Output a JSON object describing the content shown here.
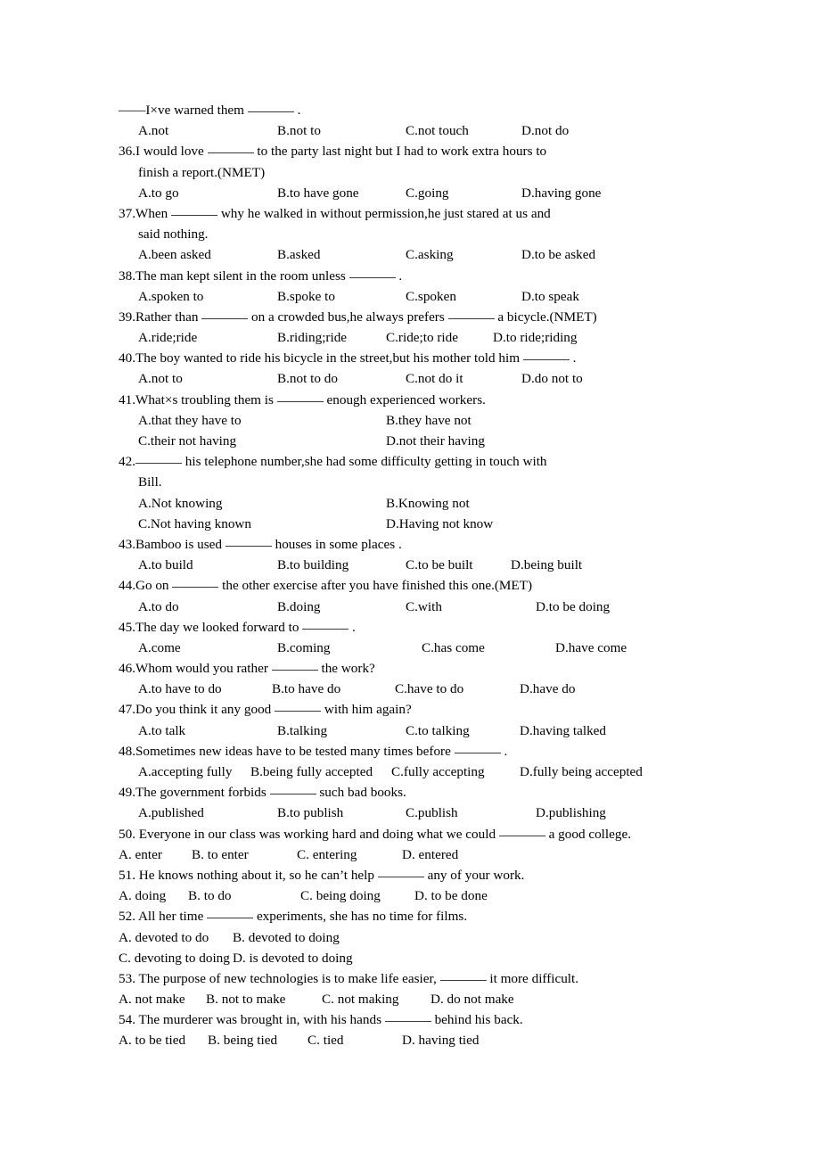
{
  "document": {
    "type": "grammar-worksheet",
    "subject": "English multiple-choice grammar exercise",
    "questions": [
      {
        "number": "",
        "stem_pre": "——I×ve warned them ",
        "stem_post": " .",
        "blank": "md",
        "cont": [],
        "layout": "indent-4col",
        "options": [
          "A.not",
          "B.not to",
          "C.not touch",
          "D.not do"
        ],
        "cols": [
          22,
          178,
          322,
          452
        ]
      },
      {
        "number": "36.",
        "stem_pre": "36.I would love ",
        "stem_post": " to the party last night but I had to work extra hours to",
        "blank": "md",
        "cont": [
          "finish a report.(NMET)"
        ],
        "layout": "indent-4col",
        "options": [
          "A.to go",
          "B.to have gone",
          "C.going",
          "D.having gone"
        ],
        "cols": [
          22,
          178,
          322,
          452
        ]
      },
      {
        "number": "37.",
        "stem_pre": "37.When ",
        "stem_post": " why he walked in without permission,he just stared at us and",
        "blank": "md",
        "cont": [
          "said nothing."
        ],
        "layout": "indent-4col",
        "options": [
          "A.been asked",
          "B.asked",
          "C.asking",
          "D.to be asked"
        ],
        "cols": [
          22,
          178,
          322,
          452
        ]
      },
      {
        "number": "38.",
        "stem_pre": "38.The man kept silent in the room unless ",
        "stem_post": " .",
        "blank": "md",
        "cont": [],
        "layout": "indent-4col",
        "options": [
          "A.spoken to",
          "B.spoke to",
          "C.spoken",
          "D.to speak"
        ],
        "cols": [
          22,
          178,
          322,
          452
        ]
      },
      {
        "number": "39.",
        "stem_pre": "39.Rather than ",
        "stem_mid": " on a crowded bus,he always prefers ",
        "stem_post": " a bicycle.(NMET)",
        "blank": "md",
        "two_blanks": true,
        "cont": [],
        "layout": "indent-4col",
        "options": [
          "A.ride;ride",
          "B.riding;ride",
          "C.ride;to ride",
          "D.to ride;riding"
        ],
        "cols": [
          22,
          178,
          300,
          420
        ]
      },
      {
        "number": "40.",
        "stem_pre": "40.The boy wanted to ride his bicycle in the street,but his mother told him ",
        "stem_post": " .",
        "blank": "md",
        "cont": [],
        "layout": "indent-4col",
        "options": [
          "A.not to",
          "B.not to do",
          "C.not do it",
          "D.do not to"
        ],
        "cols": [
          22,
          178,
          322,
          452
        ]
      },
      {
        "number": "41.",
        "stem_pre": "41.What×s troubling them is ",
        "stem_post": " enough experienced workers.",
        "blank": "md",
        "cont": [],
        "layout": "indent-2col",
        "options": [
          "A.that they have to",
          "B.they have not",
          "C.their not having",
          "D.not their having"
        ],
        "cols": [
          22,
          300
        ]
      },
      {
        "number": "42.",
        "stem_pre": "42.",
        "stem_post": " his telephone number,she had some difficulty getting in touch with",
        "blank": "md",
        "cont": [
          "Bill."
        ],
        "layout": "indent-2col",
        "options": [
          "A.Not knowing",
          "B.Knowing not",
          "C.Not having known",
          "D.Having not know"
        ],
        "cols": [
          22,
          300
        ]
      },
      {
        "number": "43.",
        "stem_pre": "43.Bamboo is used ",
        "stem_post": " houses in some places .",
        "blank": "md",
        "cont": [],
        "layout": "indent-4col",
        "options": [
          "A.to build",
          "B.to building",
          "C.to be built",
          "D.being built"
        ],
        "cols": [
          22,
          178,
          322,
          440
        ]
      },
      {
        "number": "44.",
        "stem_pre": "44.Go on ",
        "stem_post": " the other exercise after you have finished this one.(MET)",
        "blank": "md",
        "cont": [],
        "layout": "indent-4col",
        "options": [
          "A.to do",
          "B.doing",
          "C.with",
          "D.to be doing"
        ],
        "cols": [
          22,
          178,
          322,
          468
        ]
      },
      {
        "number": "45.",
        "stem_pre": "45.The day we looked forward to ",
        "stem_post": " .",
        "blank": "md",
        "cont": [],
        "layout": "indent-4col",
        "options": [
          "A.come",
          "B.coming",
          "C.has come",
          "D.have come"
        ],
        "cols": [
          22,
          178,
          340,
          490
        ]
      },
      {
        "number": "46.",
        "stem_pre": "46.Whom would you rather ",
        "stem_post": " the work?",
        "blank": "md",
        "cont": [],
        "layout": "indent-4col",
        "options": [
          "A.to have to do",
          "B.to have do",
          "C.have to do",
          "D.have do"
        ],
        "cols": [
          22,
          172,
          310,
          450
        ]
      },
      {
        "number": "47.",
        "stem_pre": "47.Do you think it any good ",
        "stem_post": " with him again?",
        "blank": "md",
        "cont": [],
        "layout": "indent-4col",
        "options": [
          "A.to talk",
          "B.talking",
          "C.to talking",
          "D.having talked"
        ],
        "cols": [
          22,
          178,
          322,
          450
        ]
      },
      {
        "number": "48.",
        "stem_pre": "48.Sometimes new ideas have to be tested many times before ",
        "stem_post": " .",
        "blank": "md",
        "cont": [],
        "layout": "indent-4col",
        "options": [
          "A.accepting fully",
          "B.being fully accepted",
          "C.fully accepting",
          "D.fully being accepted"
        ],
        "cols": [
          22,
          148,
          306,
          450
        ]
      },
      {
        "number": "49.",
        "stem_pre": "49.The government forbids ",
        "stem_post": " such bad books.",
        "blank": "md",
        "cont": [],
        "layout": "indent-4col",
        "options": [
          "A.published",
          "B.to publish",
          "C.publish",
          "D.publishing"
        ],
        "cols": [
          22,
          178,
          322,
          468
        ]
      },
      {
        "number": "50.",
        "stem_pre": "50. Everyone in our class was working hard and doing what we could ",
        "stem_post": " a good college.",
        "blank": "md",
        "cont": [],
        "layout": "flush-4col",
        "options": [
          "A. enter",
          "B. to enter",
          "C. entering",
          "D. entered"
        ],
        "cols": [
          0,
          82,
          200,
          318
        ]
      },
      {
        "number": "51.",
        "stem_pre": "51. He knows nothing about it, so he can’t help ",
        "stem_post": " any of your work.",
        "blank": "md",
        "cont": [],
        "layout": "flush-4col",
        "options": [
          "A. doing",
          "B. to do",
          "C. being doing",
          "D. to be done"
        ],
        "cols": [
          0,
          78,
          204,
          332
        ]
      },
      {
        "number": "52.",
        "stem_pre": "52. All her time ",
        "stem_post": " experiments, she has no time for films.",
        "blank": "md",
        "cont": [],
        "layout": "flush-2col",
        "options": [
          "A. devoted to do",
          "B. devoted to doing",
          "C. devoting to doing",
          "D. is devoted to doing"
        ],
        "cols": [
          0,
          128,
          0,
          148
        ]
      },
      {
        "number": "53.",
        "stem_pre": "53. The purpose of new technologies is to make life easier, ",
        "stem_post": " it more difficult.",
        "blank": "md",
        "cont": [],
        "layout": "flush-4col",
        "options": [
          "A. not make",
          "B. not to make",
          "C. not making",
          "D. do not make"
        ],
        "cols": [
          0,
          98,
          228,
          350
        ]
      },
      {
        "number": "54.",
        "stem_pre": "54. The murderer was brought in, with his hands ",
        "stem_post": " behind his back.",
        "blank": "md",
        "cont": [],
        "layout": "flush-4col",
        "options": [
          "A. to be tied",
          "B. being tied",
          "C. tied",
          "D. having tied"
        ],
        "cols": [
          0,
          100,
          212,
          318
        ]
      }
    ]
  },
  "text": {
    "q35_stem_pre": "——I×ve warned them ",
    "q35_stem_post": " ."
  }
}
